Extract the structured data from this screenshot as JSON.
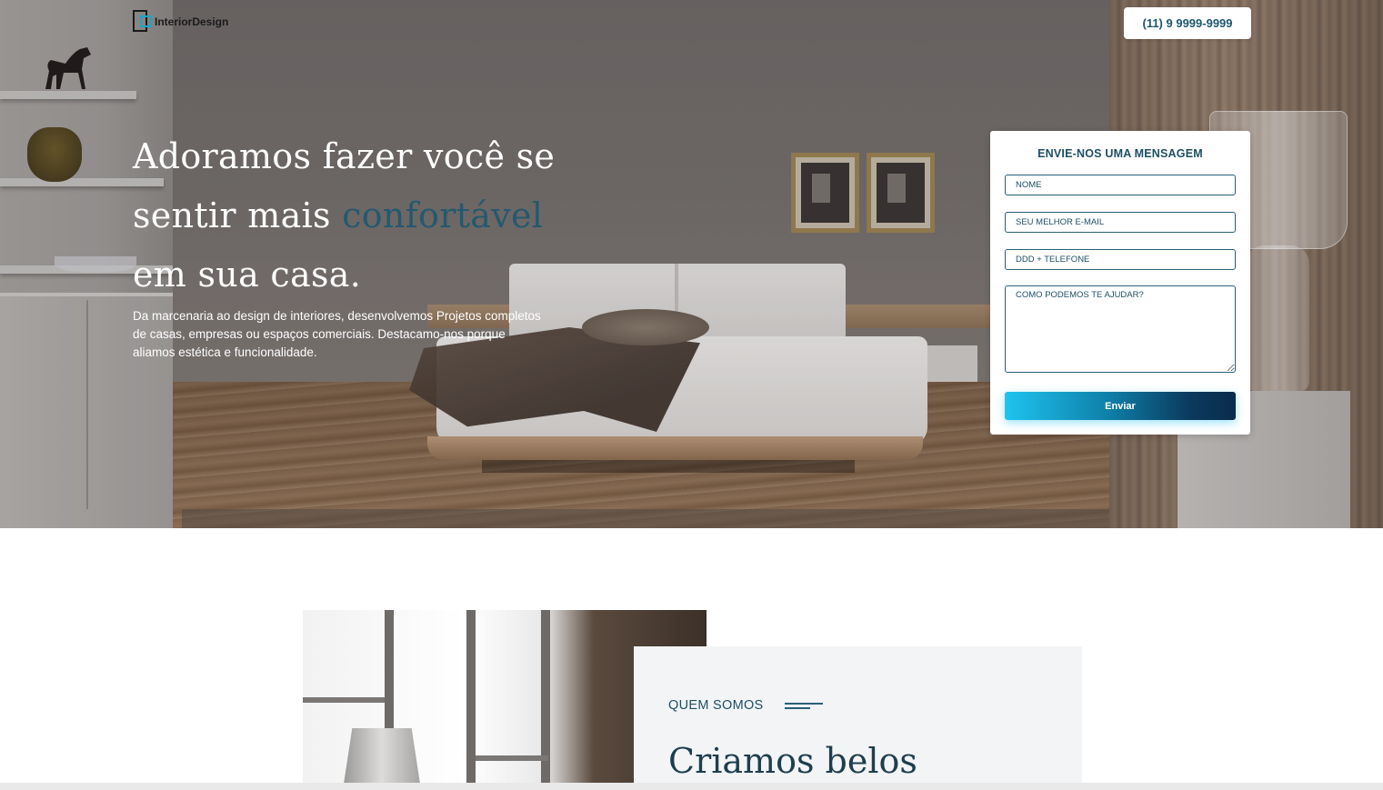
{
  "header": {
    "logo_text": "InteriorDesign",
    "phone": "(11) 9 9999-9999"
  },
  "hero": {
    "headline_line1": "Adoramos fazer você se",
    "headline_line2_plain": "sentir mais ",
    "headline_line2_accent": "confortável",
    "headline_line3": "em sua casa.",
    "lead": "Da marcenaria ao design de interiores, desenvolvemos Projetos completos de casas, empresas ou espaços comerciais. Destacamo-nos porque aliamos estética e funcionalidade."
  },
  "form": {
    "title": "ENVIE-NOS UMA MENSAGEM",
    "name_placeholder": "NOME",
    "email_placeholder": "SEU MELHOR E-MAIL",
    "phone_placeholder": "DDD + TELEFONE",
    "message_placeholder": "COMO PODEMOS TE AJUDAR?",
    "submit_label": "Enviar"
  },
  "about": {
    "label": "QUEM SOMOS",
    "title": "Criamos belos"
  },
  "colors": {
    "primary": "#1e4f66",
    "accent": "#23596e",
    "button_start": "#1ec4ef",
    "button_end": "#0a2b4c",
    "about_bg": "#f3f4f5"
  },
  "icons": {
    "logo": "square-frame-logo-icon",
    "about_decoration": "double-line-icon"
  }
}
